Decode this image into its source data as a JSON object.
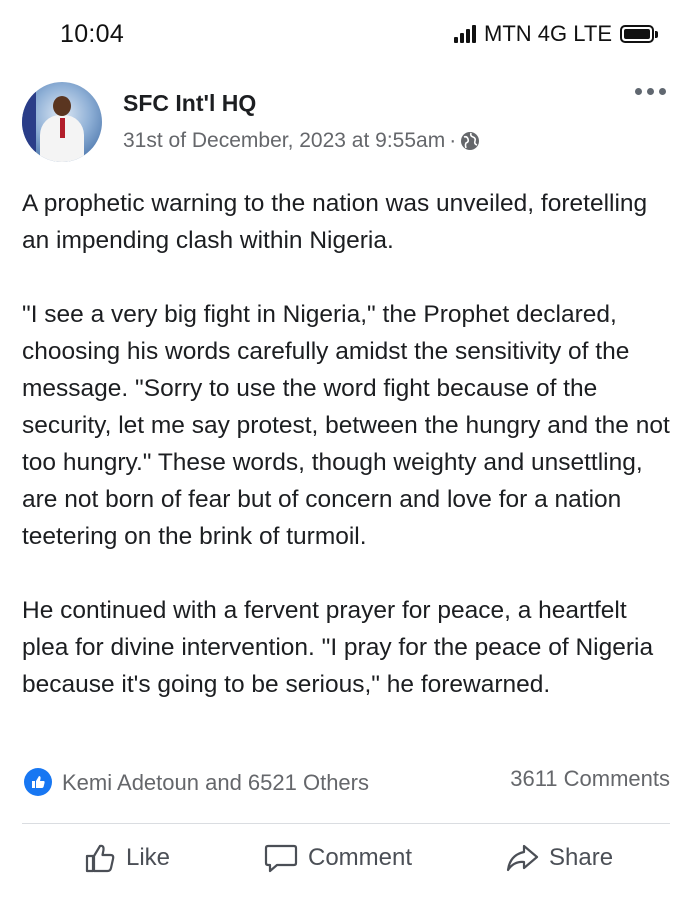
{
  "status_bar": {
    "time": "10:04",
    "carrier": "MTN 4G LTE"
  },
  "post": {
    "page_name": "SFC Int'l HQ",
    "timestamp": "31st of December, 2023 at 9:55am",
    "separator": "·",
    "privacy_icon": "globe-icon",
    "paragraphs": [
      "A prophetic warning to the nation was unveiled, foretelling an impending clash within Nigeria.",
      "\"I see a very big fight in Nigeria,\" the Prophet declared, choosing his words carefully amidst the sensitivity of the message. \"Sorry to use the word fight because of the security, let me say protest, between the hungry and the not too hungry.\" These words, though weighty and unsettling, are not born of fear but of concern and love for a nation teetering on the brink of turmoil.",
      "He continued with a fervent prayer for peace, a heartfelt plea for divine intervention. \"I pray for the peace of Nigeria because it's going to be serious,\" he forewarned."
    ]
  },
  "engagement": {
    "reactions_text": "Kemi Adetoun and 6521 Others",
    "comments_text": "3611 Comments"
  },
  "actions": {
    "like_label": "Like",
    "comment_label": "Comment",
    "share_label": "Share"
  },
  "colors": {
    "accent": "#1877f2",
    "secondary_text": "#65676b",
    "primary_text": "#1c1e21"
  }
}
